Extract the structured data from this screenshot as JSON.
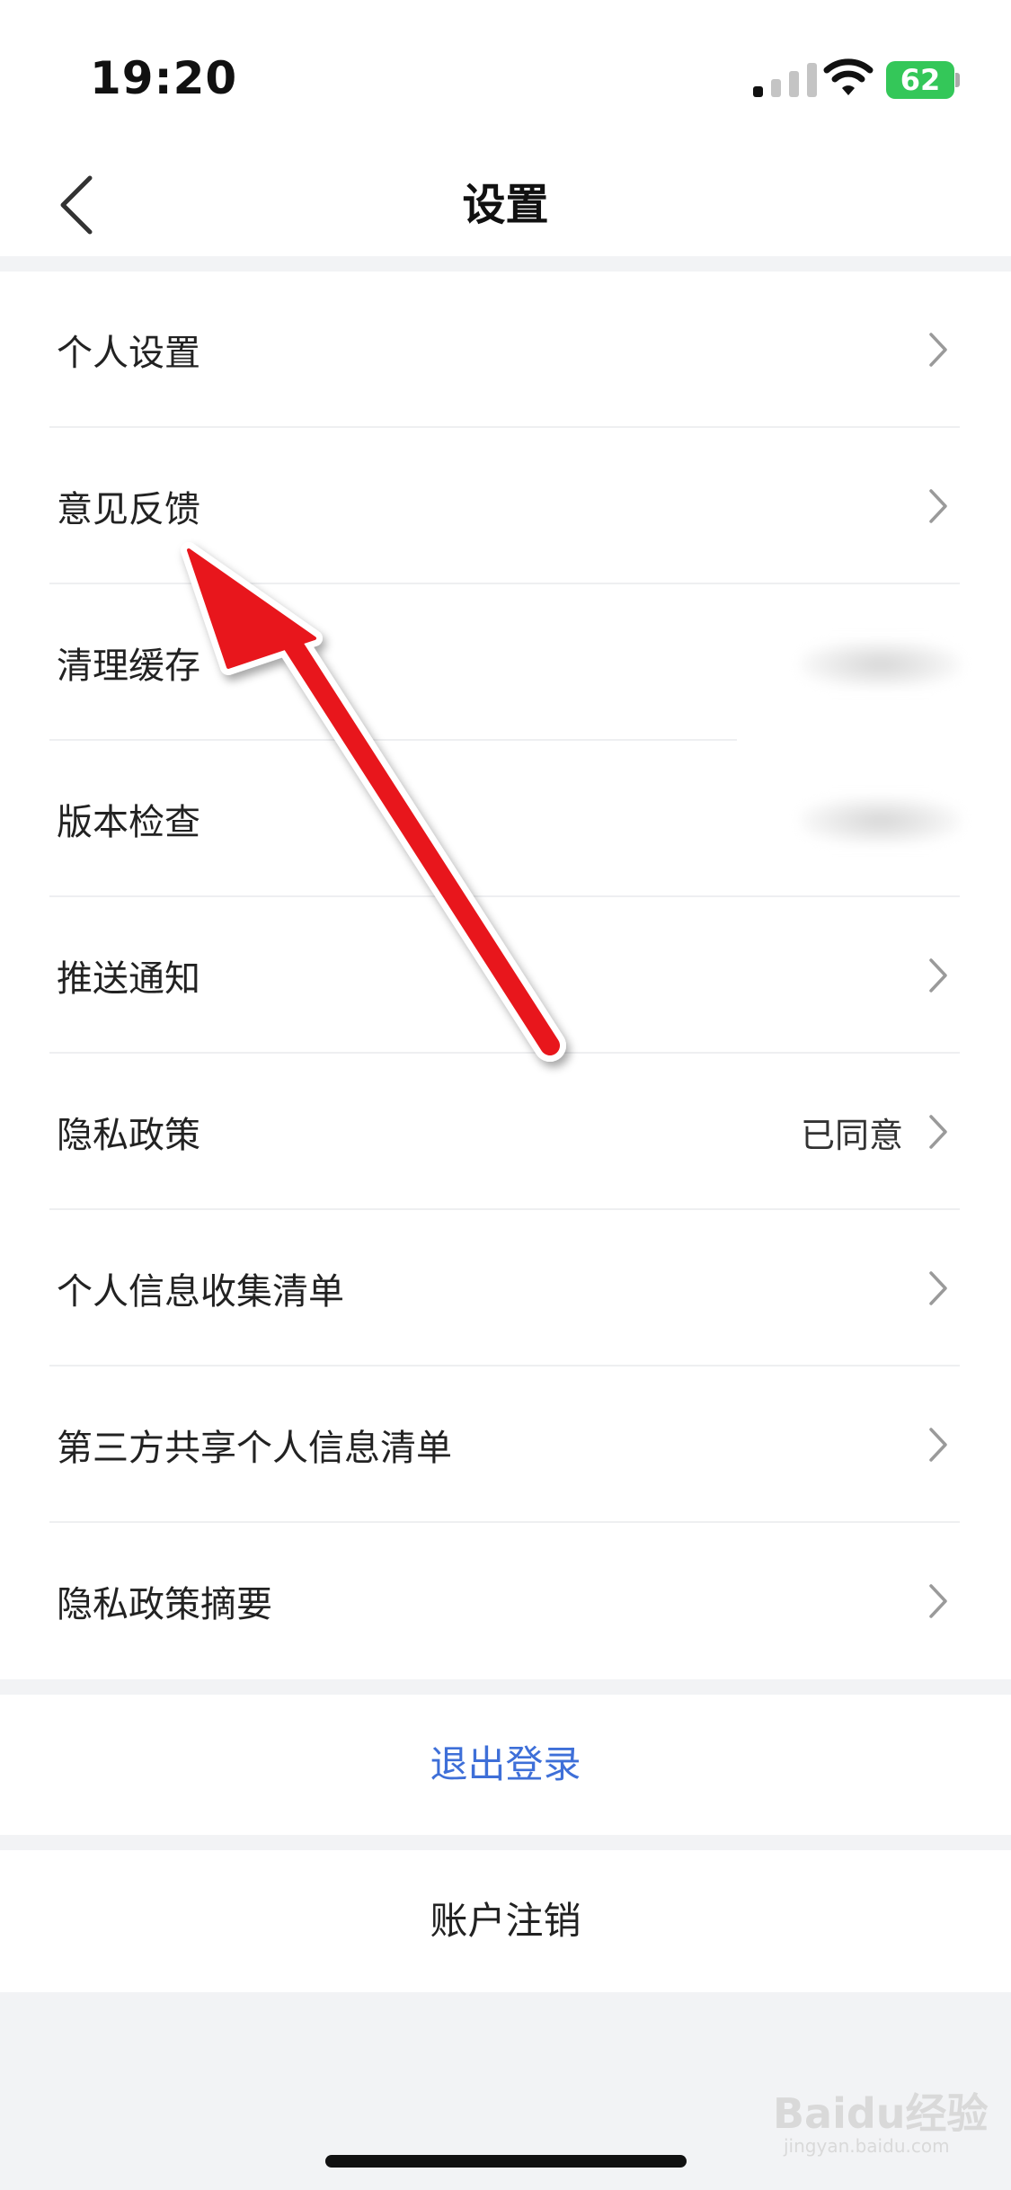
{
  "status_bar": {
    "time": "19:20",
    "battery": "62"
  },
  "nav": {
    "title": "设置",
    "back_icon": "chevron-left-icon"
  },
  "settings": {
    "items": [
      {
        "label": "个人设置",
        "value": "",
        "has_chevron": true
      },
      {
        "label": "意见反馈",
        "value": "",
        "has_chevron": true
      },
      {
        "label": "清理缓存",
        "value": "",
        "has_chevron": false
      },
      {
        "label": "版本检查",
        "value": "",
        "has_chevron": false
      },
      {
        "label": "推送通知",
        "value": "",
        "has_chevron": true
      },
      {
        "label": "隐私政策",
        "value": "已同意",
        "has_chevron": true
      },
      {
        "label": "个人信息收集清单",
        "value": "",
        "has_chevron": true
      },
      {
        "label": "第三方共享个人信息清单",
        "value": "",
        "has_chevron": true
      },
      {
        "label": "隐私政策摘要",
        "value": "",
        "has_chevron": true
      }
    ]
  },
  "actions": {
    "logout_label": "退出登录",
    "deactivate_label": "账户注销"
  },
  "watermark": {
    "text": "Baidu经验",
    "sub": "jingyan.baidu.com"
  },
  "colors": {
    "accent_blue": "#3e6fd8",
    "arrow_red": "#e8161b",
    "battery_green": "#34c759"
  }
}
